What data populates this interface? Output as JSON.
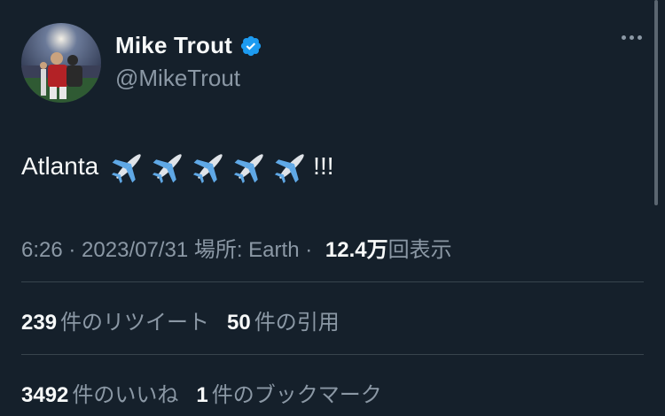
{
  "author": {
    "name": "Mike Trout",
    "handle": "@MikeTrout",
    "verified": true,
    "avatar_icon": "baseball-player-photo"
  },
  "tweet": {
    "text": "Atlanta",
    "emoji_icons": [
      "airplane-icon",
      "airplane-icon",
      "airplane-icon",
      "airplane-icon",
      "airplane-icon"
    ],
    "trailing": "!!!"
  },
  "meta": {
    "time": "6:26",
    "sep1": " · ",
    "date": "2023/07/31",
    "location_label": " 場所: Earth",
    "sep2": " · ",
    "views_count": "12.4万",
    "views_suffix": "回表示"
  },
  "stats_row1": [
    {
      "count": "239",
      "label": "件のリツイート"
    },
    {
      "count": "50",
      "label": "件の引用"
    }
  ],
  "stats_row2": [
    {
      "count": "3492",
      "label": "件のいいね"
    },
    {
      "count": "1",
      "label": "件のブックマーク"
    }
  ],
  "colors": {
    "background": "#15202b",
    "primary_text": "#f7f9f9",
    "secondary_text": "#8b98a5",
    "verified_blue": "#1d9bf0",
    "divider": "#38444d"
  }
}
